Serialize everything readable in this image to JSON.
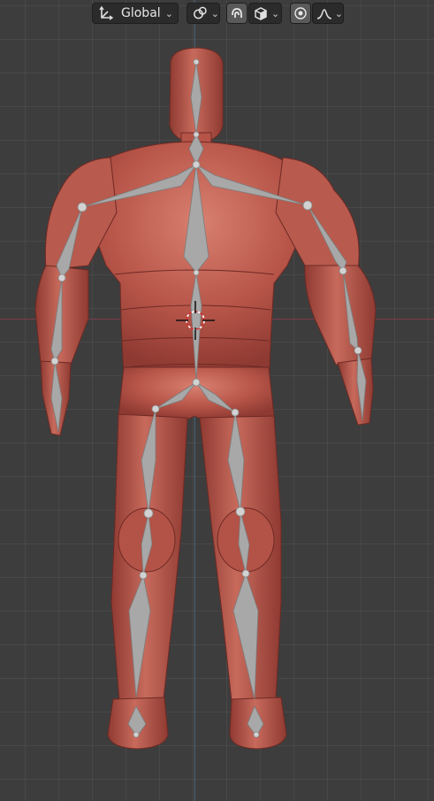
{
  "header": {
    "transform_orientation": {
      "label": "Global",
      "icon": "transform-orientation-icon"
    },
    "pivot_point": {
      "icon": "pivot-link-icon"
    },
    "snapping": {
      "icon": "snap-magnet-icon"
    },
    "snap_target": {
      "icon": "snap-cube-icon"
    },
    "proportional_editing": {
      "icon": "proportional-edit-icon"
    },
    "falloff": {
      "icon": "falloff-curve-icon"
    }
  },
  "viewport": {
    "object": "armature-character-model",
    "skin_color": "#b8554a",
    "bone_color": "#a8a8a8",
    "grid_color": "#3d3d3d",
    "x_axis_color": "#7a3d4a",
    "y_axis_color": "#45607e"
  }
}
